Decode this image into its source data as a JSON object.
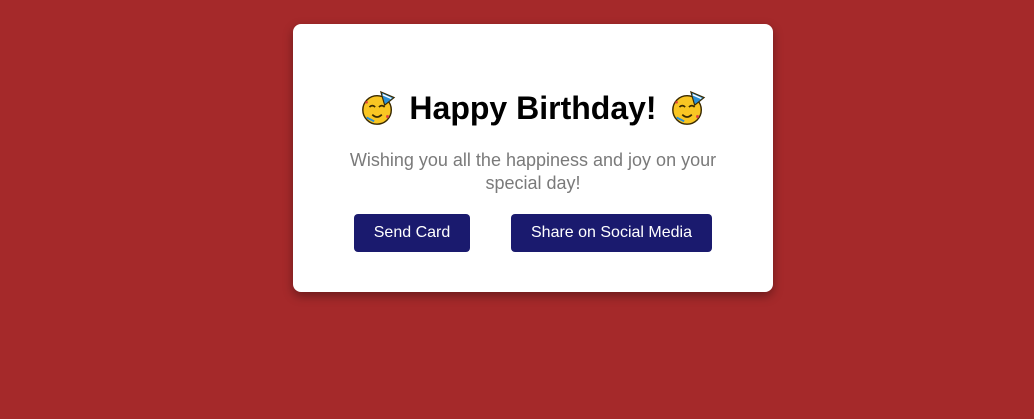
{
  "card": {
    "title": "Happy Birthday!",
    "title_icons": [
      "party-face-icon",
      "party-face-icon"
    ],
    "message": "Wishing you all the happiness and joy on your special day!",
    "buttons": {
      "send_label": "Send Card",
      "share_label": "Share on Social Media"
    }
  },
  "colors": {
    "background": "#a5292a",
    "card": "#ffffff",
    "button": "#1a1a6e",
    "button_text": "#ffffff",
    "message_text": "#7a7a7a"
  }
}
